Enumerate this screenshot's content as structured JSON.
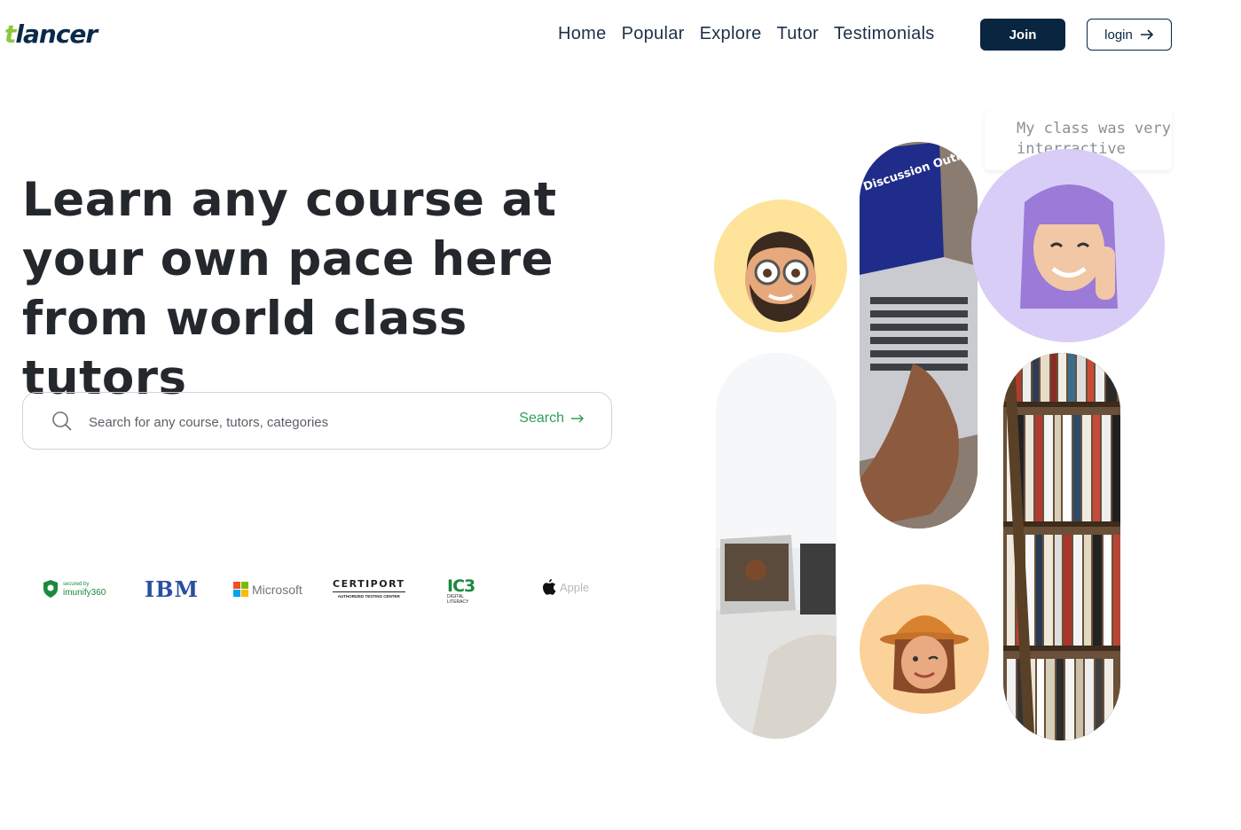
{
  "header": {
    "logo_t": "t",
    "logo_rest": "lancer",
    "nav": [
      "Home",
      "Popular",
      "Explore",
      "Tutor",
      "Testimonials"
    ],
    "join_label": "Join",
    "login_label": "login"
  },
  "hero": {
    "title": "Learn any course at your own pace here from world class tutors",
    "search_placeholder": "Search for any course, tutors, categories",
    "search_button": "Search"
  },
  "partners": {
    "imunify": "imunify360",
    "imunify_small": "secured by",
    "ibm": "IBM",
    "microsoft": "Microsoft",
    "certiport": "CERTIPORT",
    "certiport_sub": "AUTHORIZED TESTING CENTER",
    "ic3": "IC3",
    "ic3_sub": "DIGITAL LITERACY",
    "apple": "Apple"
  },
  "collage": {
    "bubble_text": "My class was very interractive",
    "laptop_screen_text": "Discussion Outline"
  },
  "colors": {
    "brand_navy": "#0a2540",
    "logo_green": "#8dc63f",
    "search_green": "#2e9e5b"
  }
}
